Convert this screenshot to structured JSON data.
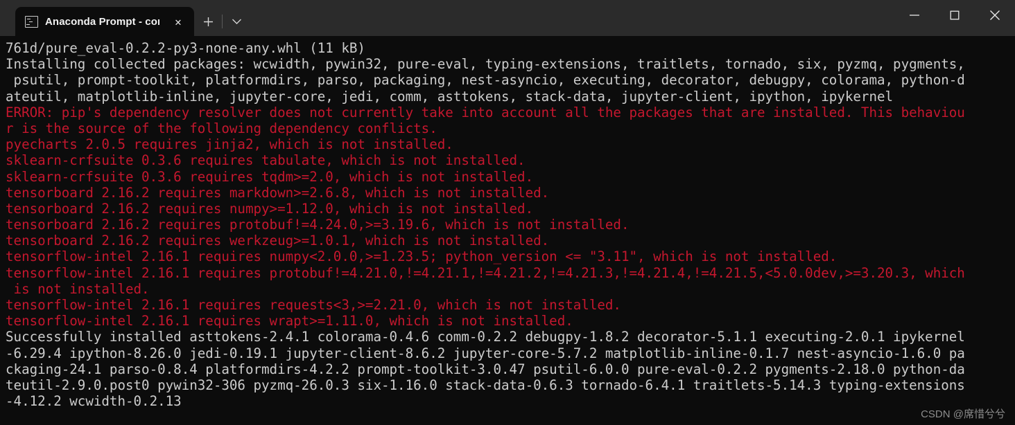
{
  "window": {
    "tab": {
      "title": "Anaconda Prompt - conda  de",
      "icon": "console-icon",
      "close_label": "✕"
    },
    "new_tab_label": "+",
    "tab_menu_label": "⌄",
    "controls": {
      "minimize": "—",
      "maximize": "□",
      "close": "✕"
    }
  },
  "colors": {
    "terminal_bg": "#0c0c0c",
    "titlebar_bg": "#2b2b2b",
    "text_white": "#cccccc",
    "text_red": "#c5172e"
  },
  "terminal": {
    "lines": [
      {
        "color": "white",
        "text": "761d/pure_eval-0.2.2-py3-none-any.whl (11 kB)"
      },
      {
        "color": "white",
        "text": "Installing collected packages: wcwidth, pywin32, pure-eval, typing-extensions, traitlets, tornado, six, pyzmq, pygments,"
      },
      {
        "color": "white",
        "text": " psutil, prompt-toolkit, platformdirs, parso, packaging, nest-asyncio, executing, decorator, debugpy, colorama, python-d"
      },
      {
        "color": "white",
        "text": "ateutil, matplotlib-inline, jupyter-core, jedi, comm, asttokens, stack-data, jupyter-client, ipython, ipykernel"
      },
      {
        "color": "red",
        "text": "ERROR: pip's dependency resolver does not currently take into account all the packages that are installed. This behaviou"
      },
      {
        "color": "red",
        "text": "r is the source of the following dependency conflicts."
      },
      {
        "color": "red",
        "text": "pyecharts 2.0.5 requires jinja2, which is not installed."
      },
      {
        "color": "red",
        "text": "sklearn-crfsuite 0.3.6 requires tabulate, which is not installed."
      },
      {
        "color": "red",
        "text": "sklearn-crfsuite 0.3.6 requires tqdm>=2.0, which is not installed."
      },
      {
        "color": "red",
        "text": "tensorboard 2.16.2 requires markdown>=2.6.8, which is not installed."
      },
      {
        "color": "red",
        "text": "tensorboard 2.16.2 requires numpy>=1.12.0, which is not installed."
      },
      {
        "color": "red",
        "text": "tensorboard 2.16.2 requires protobuf!=4.24.0,>=3.19.6, which is not installed."
      },
      {
        "color": "red",
        "text": "tensorboard 2.16.2 requires werkzeug>=1.0.1, which is not installed."
      },
      {
        "color": "red",
        "text": "tensorflow-intel 2.16.1 requires numpy<2.0.0,>=1.23.5; python_version <= \"3.11\", which is not installed."
      },
      {
        "color": "red",
        "text": "tensorflow-intel 2.16.1 requires protobuf!=4.21.0,!=4.21.1,!=4.21.2,!=4.21.3,!=4.21.4,!=4.21.5,<5.0.0dev,>=3.20.3, which"
      },
      {
        "color": "red",
        "text": " is not installed."
      },
      {
        "color": "red",
        "text": "tensorflow-intel 2.16.1 requires requests<3,>=2.21.0, which is not installed."
      },
      {
        "color": "red",
        "text": "tensorflow-intel 2.16.1 requires wrapt>=1.11.0, which is not installed."
      },
      {
        "color": "white",
        "text": "Successfully installed asttokens-2.4.1 colorama-0.4.6 comm-0.2.2 debugpy-1.8.2 decorator-5.1.1 executing-2.0.1 ipykernel"
      },
      {
        "color": "white",
        "text": "-6.29.4 ipython-8.26.0 jedi-0.19.1 jupyter-client-8.6.2 jupyter-core-5.7.2 matplotlib-inline-0.1.7 nest-asyncio-1.6.0 pa"
      },
      {
        "color": "white",
        "text": "ckaging-24.1 parso-0.8.4 platformdirs-4.2.2 prompt-toolkit-3.0.47 psutil-6.0.0 pure-eval-0.2.2 pygments-2.18.0 python-da"
      },
      {
        "color": "white",
        "text": "teutil-2.9.0.post0 pywin32-306 pyzmq-26.0.3 six-1.16.0 stack-data-0.6.3 tornado-6.4.1 traitlets-5.14.3 typing-extensions"
      },
      {
        "color": "white",
        "text": "-4.12.2 wcwidth-0.2.13"
      }
    ]
  },
  "watermark": {
    "text": "CSDN @席惜兮兮"
  }
}
